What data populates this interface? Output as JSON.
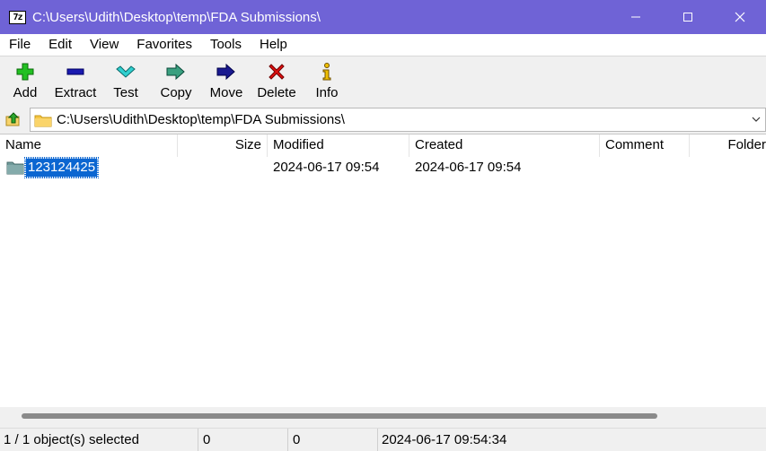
{
  "window": {
    "title": "C:\\Users\\Udith\\Desktop\\temp\\FDA Submissions\\",
    "app_icon_text": "7z",
    "title_bar_color": "#6f63d6"
  },
  "menu": [
    "File",
    "Edit",
    "View",
    "Favorites",
    "Tools",
    "Help"
  ],
  "toolbar": [
    {
      "label": "Add",
      "icon": "add-icon",
      "color": "#1fb21f"
    },
    {
      "label": "Extract",
      "icon": "extract-icon",
      "color": "#1a1aa8"
    },
    {
      "label": "Test",
      "icon": "test-icon",
      "color": "#1fb2b2"
    },
    {
      "label": "Copy",
      "icon": "copy-icon",
      "color": "#2a8a6a"
    },
    {
      "label": "Move",
      "icon": "move-icon",
      "color": "#1a1a8a"
    },
    {
      "label": "Delete",
      "icon": "delete-icon",
      "color": "#e01010"
    },
    {
      "label": "Info",
      "icon": "info-icon",
      "color": "#d9a400"
    }
  ],
  "address": {
    "path": "C:\\Users\\Udith\\Desktop\\temp\\FDA Submissions\\"
  },
  "columns": [
    "Name",
    "Size",
    "Modified",
    "Created",
    "Comment",
    "Folder"
  ],
  "rows": [
    {
      "name": "123124425",
      "size": "",
      "modified": "2024-06-17 09:54",
      "created": "2024-06-17 09:54",
      "comment": "",
      "folders": "",
      "selected": true,
      "icon": "folder-icon"
    }
  ],
  "status": {
    "selection": "1 / 1 object(s) selected",
    "size": "0",
    "packed": "0",
    "modified": "2024-06-17 09:54:34"
  }
}
